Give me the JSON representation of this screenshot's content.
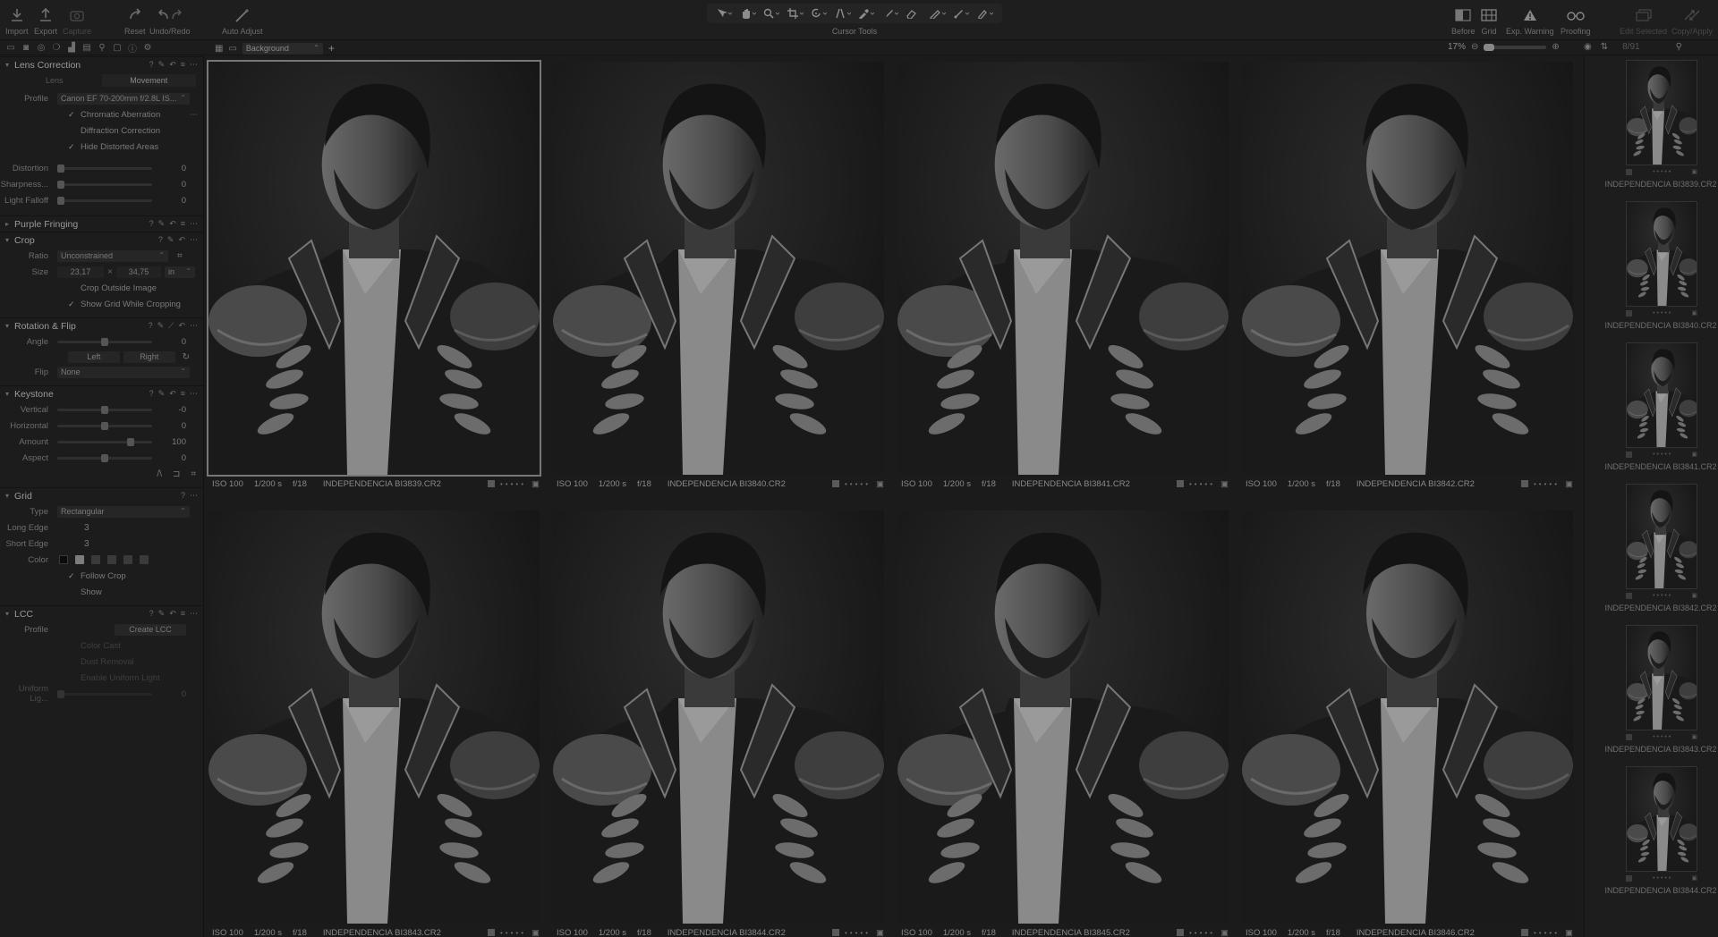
{
  "toolbar": {
    "left_buttons": [
      {
        "label": "Import",
        "icon": "import-icon"
      },
      {
        "label": "Export",
        "icon": "export-icon"
      },
      {
        "label": "Capture",
        "icon": "camera-icon"
      },
      {
        "label": "Reset",
        "icon": "reset-icon"
      },
      {
        "label": "Undo/Redo",
        "icon": "undo-redo-icon"
      },
      {
        "label": "Auto Adjust",
        "icon": "auto-adjust-wand-icon"
      }
    ],
    "cursor_tools_label": "Cursor Tools",
    "right_buttons": [
      {
        "label": "Before",
        "icon": "before-after-icon"
      },
      {
        "label": "Grid",
        "icon": "grid-icon"
      },
      {
        "label": "Exp. Warning",
        "icon": "exposure-warning-icon"
      },
      {
        "label": "Proofing",
        "icon": "proofing-glasses-icon"
      },
      {
        "label": "Edit Selected",
        "icon": "edit-selected-icon"
      },
      {
        "label": "Copy/Apply",
        "icon": "copy-apply-icon"
      }
    ]
  },
  "viewer_bar": {
    "background_select": "Background",
    "zoom": "17%",
    "image_count": "8/91"
  },
  "left_panel": {
    "lens_correction": {
      "title": "Lens Correction",
      "tabs": [
        "Lens",
        "Movement"
      ],
      "profile_label": "Profile",
      "profile_value": "Canon EF 70-200mm f/2.8L IS...",
      "checks": [
        {
          "label": "Chromatic Aberration",
          "checked": true
        },
        {
          "label": "Diffraction Correction",
          "checked": false
        },
        {
          "label": "Hide Distorted Areas",
          "checked": true
        }
      ],
      "sliders": [
        {
          "label": "Distortion",
          "value": "0"
        },
        {
          "label": "Sharpness...",
          "value": "0"
        },
        {
          "label": "Light Falloff",
          "value": "0"
        }
      ]
    },
    "purple_fringing": {
      "title": "Purple Fringing"
    },
    "crop": {
      "title": "Crop",
      "ratio_label": "Ratio",
      "ratio_value": "Unconstrained",
      "size_label": "Size",
      "width": "23,17",
      "times": "×",
      "height": "34,75",
      "unit": "in",
      "checks": [
        {
          "label": "Crop Outside Image",
          "checked": false
        },
        {
          "label": "Show Grid While Cropping",
          "checked": true
        }
      ]
    },
    "rotation": {
      "title": "Rotation & Flip",
      "angle_label": "Angle",
      "angle_value": "0",
      "left": "Left",
      "right": "Right",
      "flip_label": "Flip",
      "flip_value": "None"
    },
    "keystone": {
      "title": "Keystone",
      "sliders": [
        {
          "label": "Vertical",
          "value": "-0"
        },
        {
          "label": "Horizontal",
          "value": "0"
        },
        {
          "label": "Amount",
          "value": "100"
        },
        {
          "label": "Aspect",
          "value": "0"
        }
      ]
    },
    "grid": {
      "title": "Grid",
      "type_label": "Type",
      "type_value": "Rectangular",
      "long_edge_label": "Long Edge",
      "long_edge_value": "3",
      "short_edge_label": "Short Edge",
      "short_edge_value": "3",
      "color_label": "Color",
      "checks": [
        {
          "label": "Follow Crop",
          "checked": true
        },
        {
          "label": "Show",
          "checked": false
        }
      ]
    },
    "lcc": {
      "title": "LCC",
      "profile_label": "Profile",
      "create_button": "Create LCC",
      "checks": [
        "Color Cast",
        "Dust Removal",
        "Enable Uniform Light"
      ],
      "uniform_label": "Uniform Lig...",
      "uniform_value": "0"
    }
  },
  "grid_images": [
    {
      "iso": "ISO 100",
      "shutter": "1/200 s",
      "aperture": "f/18",
      "filename": "INDEPENDENCIA BI3839.CR2",
      "selected": true
    },
    {
      "iso": "ISO 100",
      "shutter": "1/200 s",
      "aperture": "f/18",
      "filename": "INDEPENDENCIA BI3840.CR2",
      "selected": false
    },
    {
      "iso": "ISO 100",
      "shutter": "1/200 s",
      "aperture": "f/18",
      "filename": "INDEPENDENCIA BI3841.CR2",
      "selected": false
    },
    {
      "iso": "ISO 100",
      "shutter": "1/200 s",
      "aperture": "f/18",
      "filename": "INDEPENDENCIA BI3842.CR2",
      "selected": false
    },
    {
      "iso": "ISO 100",
      "shutter": "1/200 s",
      "aperture": "f/18",
      "filename": "INDEPENDENCIA BI3843.CR2",
      "selected": false
    },
    {
      "iso": "ISO 100",
      "shutter": "1/200 s",
      "aperture": "f/18",
      "filename": "INDEPENDENCIA BI3844.CR2",
      "selected": false
    },
    {
      "iso": "ISO 100",
      "shutter": "1/200 s",
      "aperture": "f/18",
      "filename": "INDEPENDENCIA BI3845.CR2",
      "selected": false
    },
    {
      "iso": "ISO 100",
      "shutter": "1/200 s",
      "aperture": "f/18",
      "filename": "INDEPENDENCIA BI3846.CR2",
      "selected": false
    }
  ],
  "filmstrip": [
    "INDEPENDENCIA BI3839.CR2",
    "INDEPENDENCIA BI3840.CR2",
    "INDEPENDENCIA BI3841.CR2",
    "INDEPENDENCIA BI3842.CR2",
    "INDEPENDENCIA BI3843.CR2",
    "INDEPENDENCIA BI3844.CR2"
  ],
  "colors": {
    "background": "#1b1b1b",
    "panel": "#1c1c1c",
    "text": "#8a8a8a",
    "selection_border": "#777777"
  }
}
